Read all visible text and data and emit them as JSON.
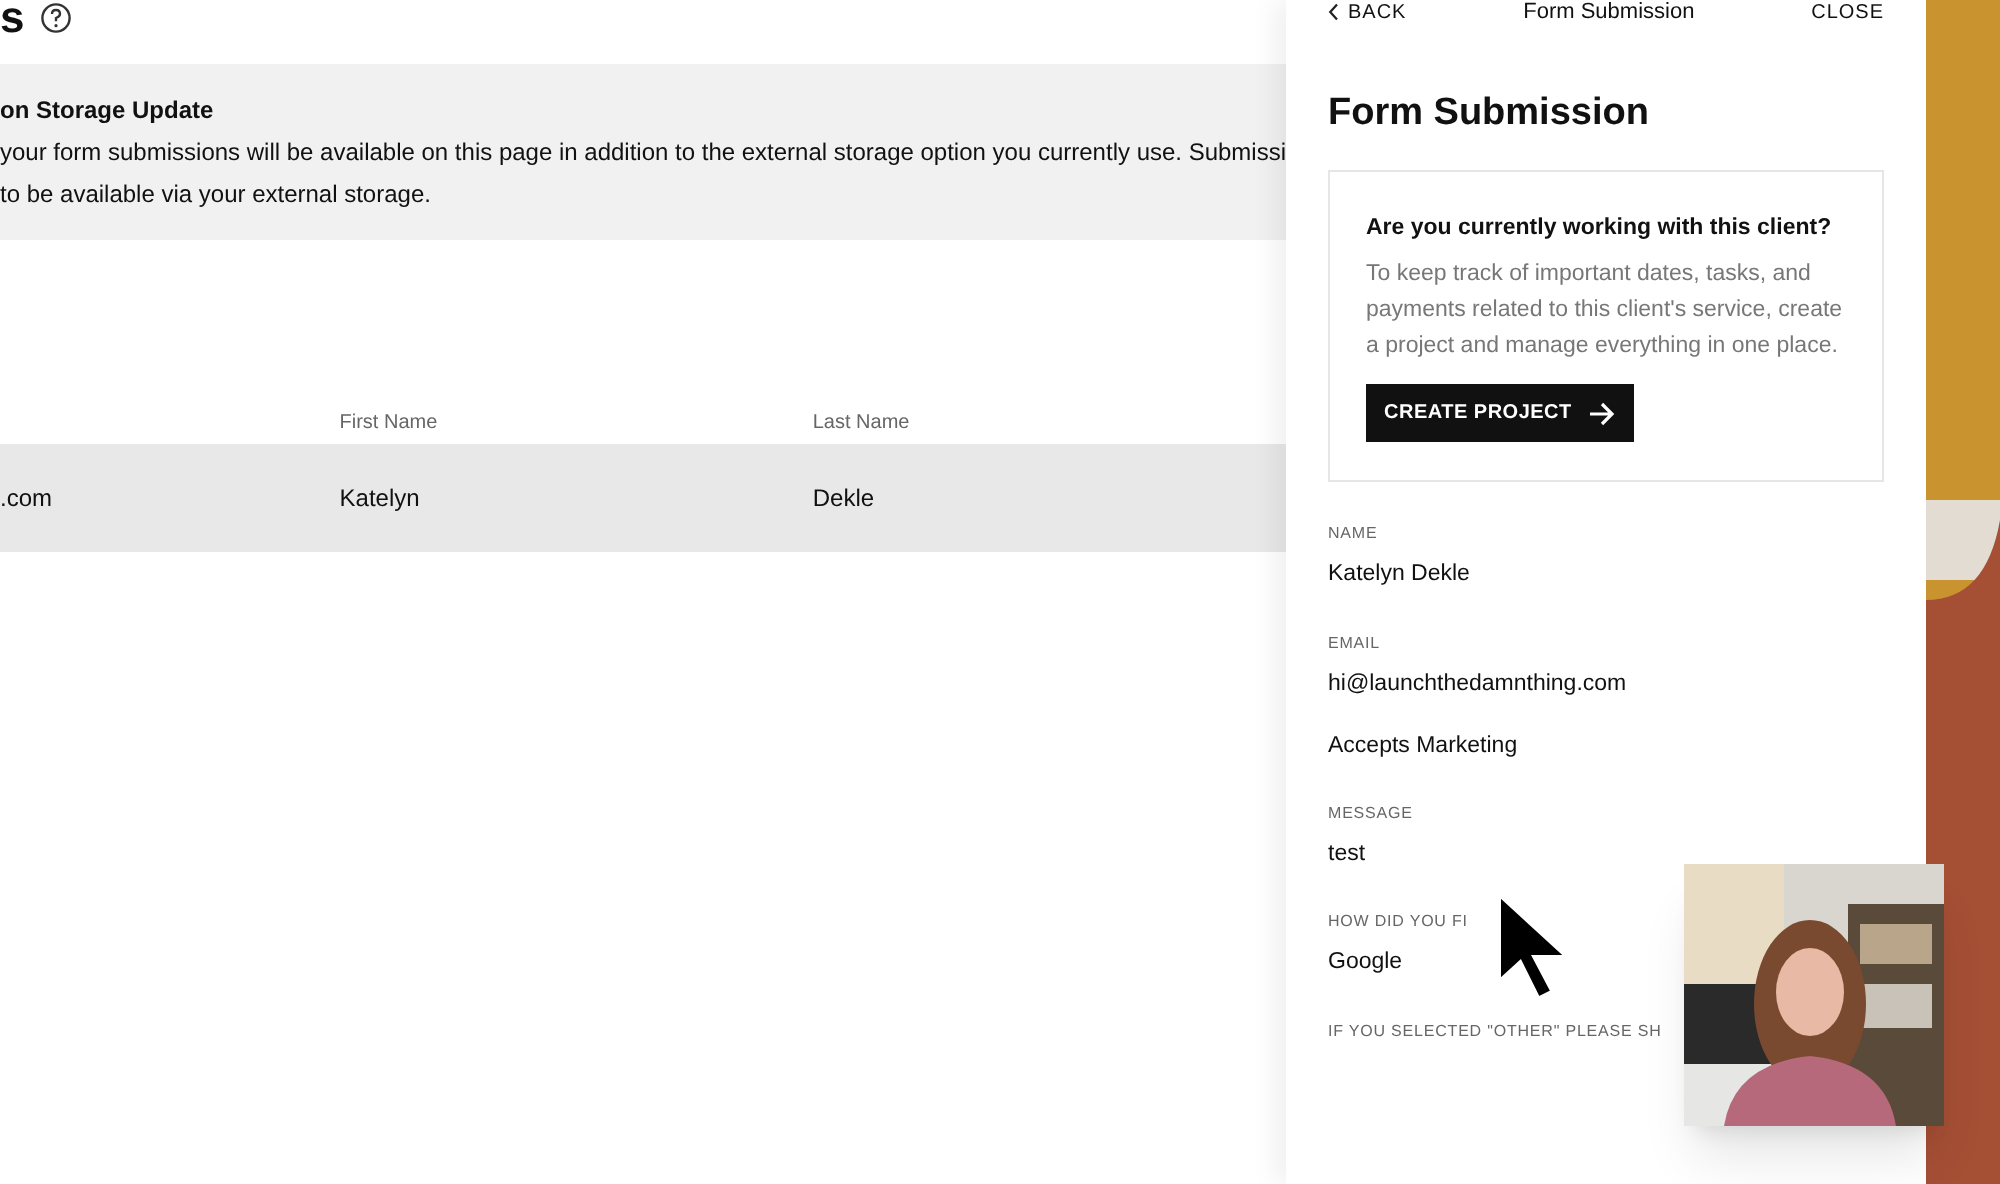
{
  "page": {
    "title": "s",
    "banner": {
      "title": "on Storage Update",
      "text": "your form submissions will be available on this page in addition to the external storage option you currently use. Submissi",
      "text_2": "to be available via your external storage."
    },
    "table": {
      "columns": [
        "",
        "First Name",
        "Last Name"
      ],
      "rows": [
        {
          "cells": [
            ".com",
            "Katelyn",
            "Dekle"
          ],
          "selected": true
        }
      ]
    }
  },
  "panel": {
    "back": "BACK",
    "header_title": "Form Submission",
    "close": "CLOSE",
    "title": "Form Submission",
    "prompt": {
      "title": "Are you currently working with this client?",
      "text": "To keep track of important dates, tasks, and payments related to this client's service, create a project and manage everything in one place.",
      "button": "CREATE PROJECT"
    },
    "fields": [
      {
        "label": "NAME",
        "value": "Katelyn Dekle"
      },
      {
        "label": "EMAIL",
        "value": "hi@launchthedamnthing.com",
        "note": "Accepts Marketing"
      },
      {
        "label": "MESSAGE",
        "value": "test"
      },
      {
        "label": "HOW DID YOU FI",
        "value": "Google"
      },
      {
        "label": "IF YOU SELECTED \"OTHER\" PLEASE SH"
      }
    ]
  }
}
